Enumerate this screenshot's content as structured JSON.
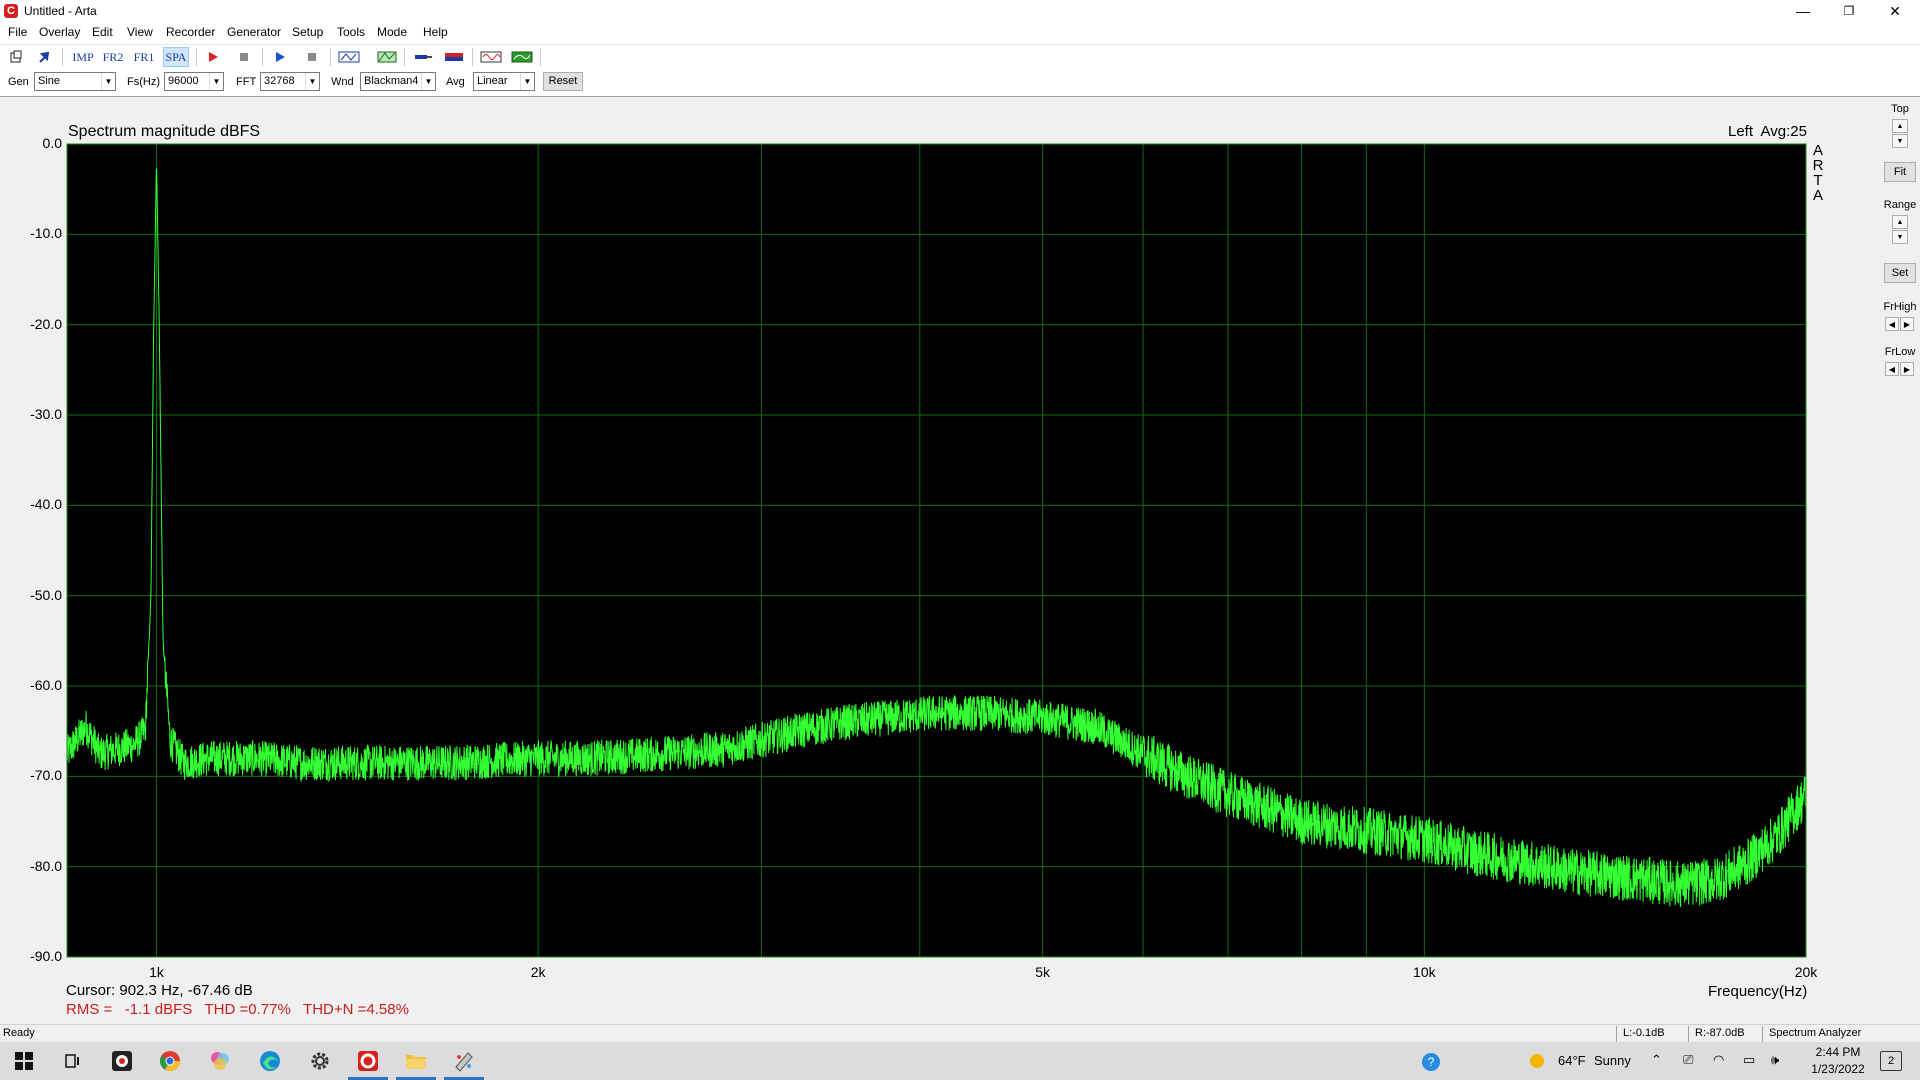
{
  "window": {
    "title": "Untitled - Arta",
    "app_icon_letter": "C",
    "minimize": "—",
    "restore": "❐",
    "close": "✕"
  },
  "menu": [
    "File",
    "Overlay",
    "Edit",
    "View",
    "Recorder",
    "Generator",
    "Setup",
    "Tools",
    "Mode",
    "Help"
  ],
  "toolbar": {
    "buttons": [
      {
        "name": "new",
        "icon": "new-doc-icon"
      },
      {
        "name": "open",
        "icon": "open-arrow-icon"
      },
      {
        "name": "imp",
        "label": "IMP"
      },
      {
        "name": "fr2",
        "label": "FR2"
      },
      {
        "name": "fr1",
        "label": "FR1"
      },
      {
        "name": "spa",
        "label": "SPA",
        "selected": true
      },
      {
        "name": "record",
        "icon": "record-icon"
      },
      {
        "name": "stop-record",
        "icon": "stop-icon"
      },
      {
        "name": "play",
        "icon": "play-icon"
      },
      {
        "name": "stop-play",
        "icon": "stop-icon"
      },
      {
        "name": "abc",
        "icon": "abc-icon"
      },
      {
        "name": "filter",
        "icon": "filter-icon"
      },
      {
        "name": "probe",
        "icon": "probe-icon"
      },
      {
        "name": "flag",
        "icon": "flag-icon"
      },
      {
        "name": "wave",
        "icon": "waveform-icon"
      },
      {
        "name": "meter",
        "icon": "meter-icon"
      }
    ]
  },
  "options": {
    "gen_label": "Gen",
    "gen_value": "Sine",
    "fs_label": "Fs(Hz)",
    "fs_value": "96000",
    "fft_label": "FFT",
    "fft_value": "32768",
    "wnd_label": "Wnd",
    "wnd_value": "Blackman4",
    "avg_label": "Avg",
    "avg_value": "Linear",
    "reset_label": "Reset"
  },
  "plot": {
    "title": "Spectrum magnitude dBFS",
    "status": "Left  Avg:25",
    "logo": [
      "A",
      "R",
      "T",
      "A"
    ],
    "cursor_label": "Cursor:",
    "cursor_value": "902.3 Hz, -67.46 dB",
    "measurement": "RMS =   -1.1 dBFS   THD =0.77%   THD+N =4.58%",
    "xaxis_title": "Frequency(Hz)",
    "colors": {
      "background": "#000000",
      "grid": "#0f6b0f",
      "trace": "#33ff33",
      "border": "#1a8c1a",
      "measurement": "#c81e1e"
    }
  },
  "chart_data": {
    "type": "line",
    "title": "Spectrum magnitude dBFS",
    "xlabel": "Frequency(Hz)",
    "ylabel": "",
    "x_scale": "log",
    "xlim": [
      850,
      20000
    ],
    "ylim": [
      -90,
      0
    ],
    "x_ticks": [
      "1k",
      "2k",
      "5k",
      "10k",
      "20k"
    ],
    "x_tick_values": [
      1000,
      2000,
      5000,
      10000,
      20000
    ],
    "y_ticks": [
      "0.0",
      "-10.0",
      "-20.0",
      "-30.0",
      "-40.0",
      "-50.0",
      "-60.0",
      "-70.0",
      "-80.0",
      "-90.0"
    ],
    "y_tick_values": [
      0,
      -10,
      -20,
      -30,
      -40,
      -50,
      -60,
      -70,
      -80,
      -90
    ],
    "grid": true,
    "series": [
      {
        "points": [
          [
            850,
            -67.5
          ],
          [
            880,
            -64.5
          ],
          [
            902,
            -67.5
          ],
          [
            930,
            -67
          ],
          [
            960,
            -66.5
          ],
          [
            980,
            -65
          ],
          [
            990,
            -50
          ],
          [
            995,
            -20
          ],
          [
            1000,
            -1.5
          ],
          [
            1005,
            -20
          ],
          [
            1012,
            -55
          ],
          [
            1025,
            -66
          ],
          [
            1050,
            -68.5
          ],
          [
            1100,
            -68
          ],
          [
            1200,
            -68
          ],
          [
            1300,
            -68.5
          ],
          [
            1500,
            -68.5
          ],
          [
            1700,
            -68.5
          ],
          [
            2000,
            -68
          ],
          [
            2200,
            -68
          ],
          [
            2500,
            -67.5
          ],
          [
            2800,
            -67
          ],
          [
            3000,
            -66
          ],
          [
            3200,
            -65
          ],
          [
            3500,
            -64
          ],
          [
            3800,
            -63.5
          ],
          [
            4100,
            -63
          ],
          [
            4500,
            -63
          ],
          [
            5000,
            -63.5
          ],
          [
            5500,
            -64.5
          ],
          [
            6000,
            -67.5
          ],
          [
            6500,
            -70
          ],
          [
            7000,
            -72
          ],
          [
            7500,
            -73.5
          ],
          [
            8000,
            -75
          ],
          [
            9000,
            -76
          ],
          [
            10000,
            -77
          ],
          [
            11000,
            -78.5
          ],
          [
            12000,
            -79.5
          ],
          [
            13000,
            -80.5
          ],
          [
            14000,
            -81
          ],
          [
            15000,
            -81.5
          ],
          [
            16000,
            -82
          ],
          [
            17000,
            -81.5
          ],
          [
            18000,
            -79.5
          ],
          [
            19000,
            -76.5
          ],
          [
            20000,
            -72
          ]
        ]
      }
    ]
  },
  "right_panel": {
    "top_label": "Top",
    "fit_label": "Fit",
    "range_label": "Range",
    "set_label": "Set",
    "frhigh_label": "FrHigh",
    "frlow_label": "FrLow"
  },
  "statusbar": {
    "ready": "Ready",
    "left_level": "L:-0.1dB",
    "right_level": "R:-87.0dB",
    "mode": "Spectrum Analyzer"
  },
  "taskbar": {
    "weather_temp": "64°F",
    "weather_text": "Sunny",
    "time": "2:44 PM",
    "date": "1/23/2022",
    "notification_count": "2"
  }
}
